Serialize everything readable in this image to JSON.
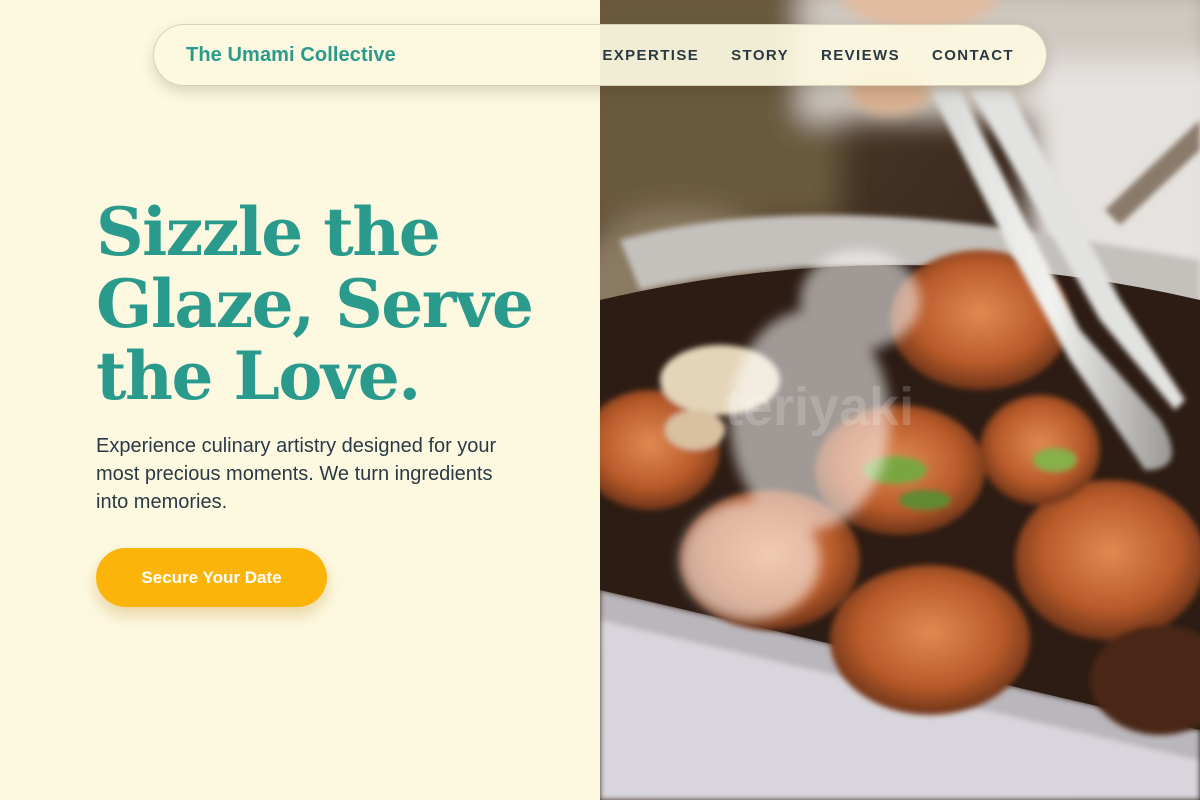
{
  "brand": {
    "name": "The Umami Collective"
  },
  "nav": {
    "items": [
      {
        "label": "EXPERTISE"
      },
      {
        "label": "STORY"
      },
      {
        "label": "REVIEWS"
      },
      {
        "label": "CONTACT"
      }
    ]
  },
  "hero": {
    "headline_lines": [
      "Sizzle the",
      "Glaze, Serve",
      "the Love."
    ],
    "subtext": "Experience culinary artistry designed for your most precious moments. We turn ingredients into memories.",
    "cta_label": "Secure Your Date",
    "image_watermark": "teriyaki"
  },
  "colors": {
    "accent": "#2a9a8c",
    "cta": "#fbb50a",
    "background": "#fdf9e1",
    "text_dark": "#2a3a45"
  }
}
